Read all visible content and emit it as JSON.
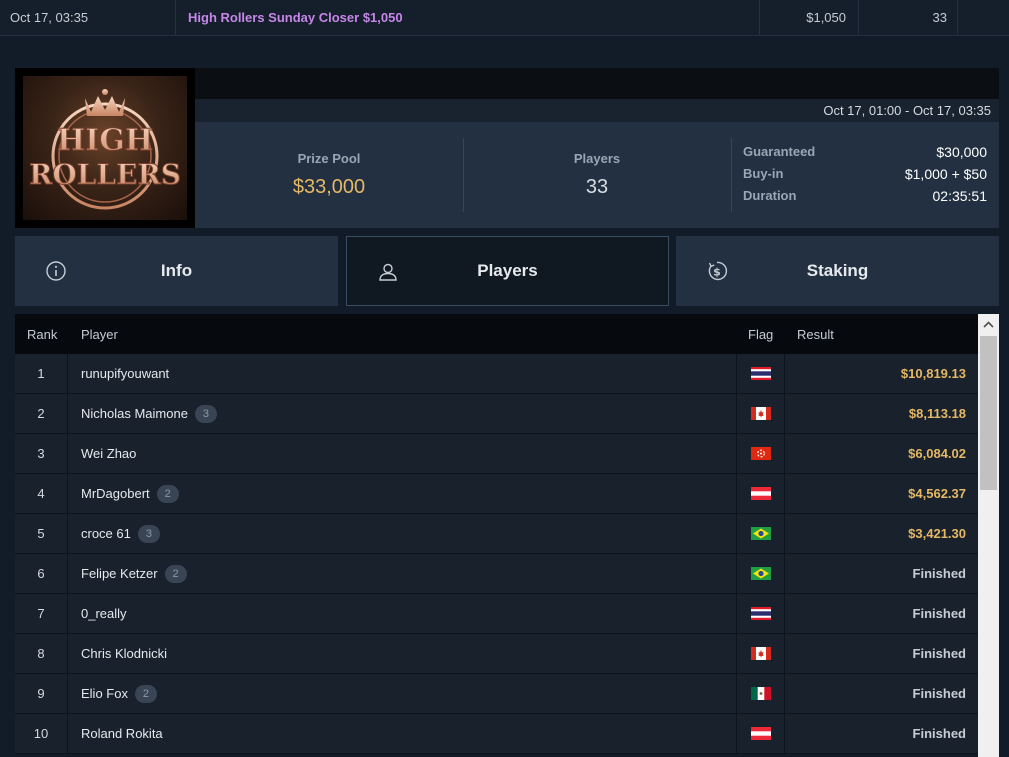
{
  "top_row": {
    "date": "Oct 17, 03:35",
    "name": "High Rollers Sunday Closer $1,050",
    "buyin": "$1,050",
    "players": "33"
  },
  "logo": {
    "line1": "HIGH",
    "line2": "ROLLERS"
  },
  "tournament": {
    "date_range": "Oct 17, 01:00 - Oct 17, 03:35",
    "prize_pool_label": "Prize Pool",
    "prize_pool": "$33,000",
    "players_label": "Players",
    "players": "33",
    "details": [
      {
        "label": "Guaranteed",
        "value": "$30,000"
      },
      {
        "label": "Buy-in",
        "value": "$1,000 + $50"
      },
      {
        "label": "Duration",
        "value": "02:35:51"
      }
    ]
  },
  "tabs": [
    {
      "label": "Info",
      "icon": "info-icon",
      "active": false
    },
    {
      "label": "Players",
      "icon": "user-icon",
      "active": true
    },
    {
      "label": "Staking",
      "icon": "dollar-icon",
      "active": false
    }
  ],
  "table": {
    "headers": {
      "rank": "Rank",
      "player": "Player",
      "flag": "Flag",
      "result": "Result"
    },
    "rows": [
      {
        "rank": "1",
        "player": "runupifyouwant",
        "badge": "",
        "flag": "thailand",
        "result": "$10,819.13",
        "paid": true
      },
      {
        "rank": "2",
        "player": "Nicholas Maimone",
        "badge": "3",
        "flag": "canada",
        "result": "$8,113.18",
        "paid": true
      },
      {
        "rank": "3",
        "player": "Wei Zhao",
        "badge": "",
        "flag": "hong-kong",
        "result": "$6,084.02",
        "paid": true
      },
      {
        "rank": "4",
        "player": "MrDagobert",
        "badge": "2",
        "flag": "austria",
        "result": "$4,562.37",
        "paid": true
      },
      {
        "rank": "5",
        "player": "croce 61",
        "badge": "3",
        "flag": "brazil",
        "result": "$3,421.30",
        "paid": true
      },
      {
        "rank": "6",
        "player": "Felipe Ketzer",
        "badge": "2",
        "flag": "brazil",
        "result": "Finished",
        "paid": false
      },
      {
        "rank": "7",
        "player": "0_really",
        "badge": "",
        "flag": "thailand",
        "result": "Finished",
        "paid": false
      },
      {
        "rank": "8",
        "player": "Chris Klodnicki",
        "badge": "",
        "flag": "canada",
        "result": "Finished",
        "paid": false
      },
      {
        "rank": "9",
        "player": "Elio Fox",
        "badge": "2",
        "flag": "mexico",
        "result": "Finished",
        "paid": false
      },
      {
        "rank": "10",
        "player": "Roland Rokita",
        "badge": "",
        "flag": "austria",
        "result": "Finished",
        "paid": false
      }
    ]
  },
  "colors": {
    "accent_gold": "#e5b865",
    "accent_purple": "#c586e8",
    "panel": "#223041",
    "background": "#121c28"
  }
}
